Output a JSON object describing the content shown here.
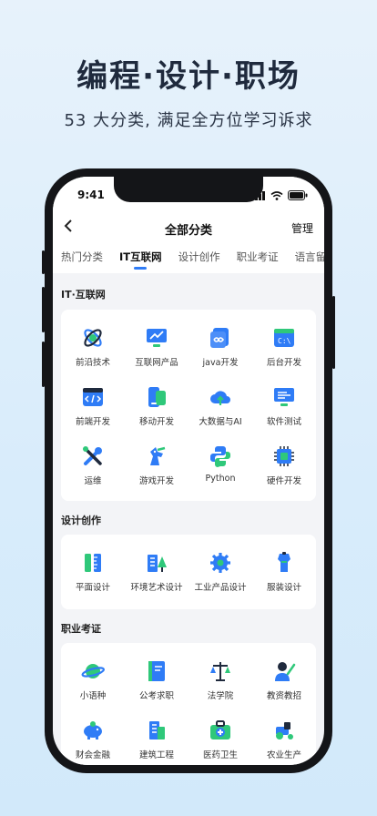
{
  "hero": {
    "title": "编程·设计·职场",
    "subtitle": "53 大分类, 满足全方位学习诉求"
  },
  "status": {
    "time": "9:41"
  },
  "nav": {
    "back_icon": "chevron-left-icon",
    "title": "全部分类",
    "manage": "管理"
  },
  "tabs": [
    "热门分类",
    "IT互联网",
    "设计创作",
    "职业考证",
    "语言留学"
  ],
  "active_tab": "IT互联网",
  "sections": [
    {
      "title": "IT·互联网",
      "items": [
        {
          "label": "前沿技术",
          "icon": "atom-icon"
        },
        {
          "label": "互联网产品",
          "icon": "monitor-chart-icon"
        },
        {
          "label": "java开发",
          "icon": "infinity-folder-icon"
        },
        {
          "label": "后台开发",
          "icon": "terminal-icon"
        },
        {
          "label": "前端开发",
          "icon": "code-window-icon"
        },
        {
          "label": "移动开发",
          "icon": "mobile-icon"
        },
        {
          "label": "大数据与AI",
          "icon": "cloud-upload-icon"
        },
        {
          "label": "软件测试",
          "icon": "test-screen-icon"
        },
        {
          "label": "运维",
          "icon": "tools-icon"
        },
        {
          "label": "游戏开发",
          "icon": "game-horse-icon"
        },
        {
          "label": "Python",
          "icon": "python-icon"
        },
        {
          "label": "硬件开发",
          "icon": "chip-icon"
        }
      ]
    },
    {
      "title": "设计创作",
      "items": [
        {
          "label": "平面设计",
          "icon": "pencil-ruler-icon"
        },
        {
          "label": "环境艺术设计",
          "icon": "building-tree-icon"
        },
        {
          "label": "工业产品设计",
          "icon": "gear-icon"
        },
        {
          "label": "服装设计",
          "icon": "mannequin-icon"
        }
      ]
    },
    {
      "title": "职业考证",
      "items": [
        {
          "label": "小语种",
          "icon": "planet-icon"
        },
        {
          "label": "公考求职",
          "icon": "book-icon"
        },
        {
          "label": "法学院",
          "icon": "scales-icon"
        },
        {
          "label": "教资教招",
          "icon": "teacher-icon"
        },
        {
          "label": "财会金融",
          "icon": "piggy-bank-icon"
        },
        {
          "label": "建筑工程",
          "icon": "building-icon"
        },
        {
          "label": "医药卫生",
          "icon": "medical-kit-icon"
        },
        {
          "label": "农业生产",
          "icon": "tractor-icon"
        }
      ]
    }
  ],
  "colors": {
    "accent": "#2f7cf6",
    "green": "#2fc87a",
    "dark": "#1f2a3d"
  }
}
